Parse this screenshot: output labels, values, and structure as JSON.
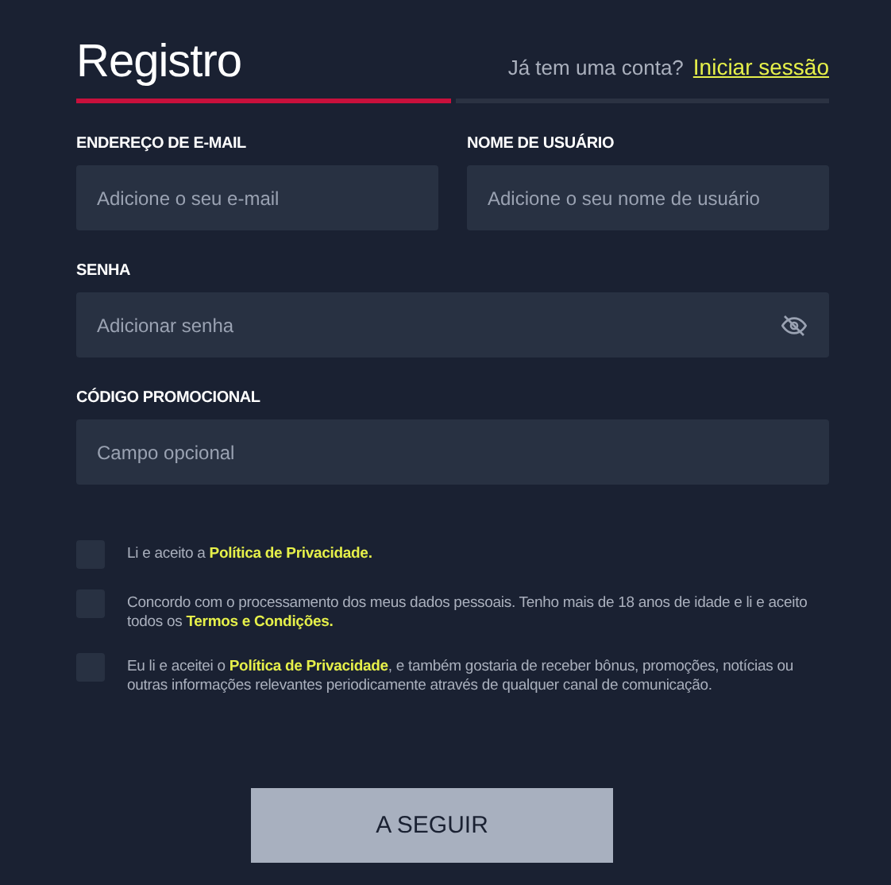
{
  "title": "Registro",
  "login_prompt": {
    "text": "Já tem uma conta?",
    "link": "Iniciar sessão"
  },
  "steps": [
    {
      "selected": true
    },
    {
      "selected": false
    }
  ],
  "fields": [
    {
      "label": "ENDEREÇO DE E-MAIL",
      "placeholder": "Adicione o seu e-mail",
      "kind": "text"
    },
    {
      "label": "NOME DE USUÁRIO",
      "placeholder": "Adicione o seu nome de usuário",
      "kind": "text"
    },
    {
      "label": "SENHA",
      "placeholder": "Adicionar senha",
      "kind": "password"
    },
    {
      "label": "CÓDIGO PROMOCIONAL",
      "placeholder": "Campo opcional",
      "kind": "text"
    }
  ],
  "consents": [
    {
      "checked": false,
      "before": "Li e aceito a ",
      "link": "Política de Privacidade."
    },
    {
      "checked": false,
      "before": "Concordo com o processamento dos meus dados pessoais. Tenho mais de 18 anos de idade e li e aceito todos os ",
      "link": "Termos e Condições."
    },
    {
      "checked": false,
      "before": "Eu li e aceitei o ",
      "link": "Política de Privacidade",
      "after": ", e também gostaria de receber bônus, promoções, notícias ou outras informações relevantes periodicamente através de qualquer canal de comunicação."
    }
  ],
  "submit": "A SEGUIR"
}
